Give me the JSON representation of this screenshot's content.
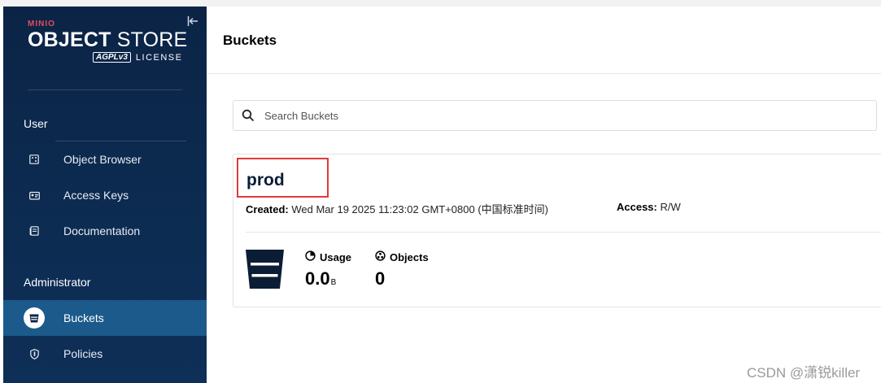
{
  "brand": {
    "minio": "MINIO",
    "object": "OBJECT",
    "store": " STORE",
    "agpl": "AGPLv3",
    "license": "LICENSE",
    "collapse_icon": "collapse-left-icon"
  },
  "sidebar": {
    "user_section": "User",
    "user_items": [
      {
        "label": "Object Browser",
        "icon": "object-browser-icon"
      },
      {
        "label": "Access Keys",
        "icon": "access-keys-icon"
      },
      {
        "label": "Documentation",
        "icon": "documentation-icon"
      }
    ],
    "admin_section": "Administrator",
    "admin_items": [
      {
        "label": "Buckets",
        "icon": "bucket-icon",
        "active": true
      },
      {
        "label": "Policies",
        "icon": "policies-icon"
      }
    ]
  },
  "page": {
    "title": "Buckets"
  },
  "search": {
    "placeholder": "Search Buckets",
    "value": ""
  },
  "bucket": {
    "name": "prod",
    "created_label": "Created:",
    "created_value": "Wed Mar 19 2025 11:23:02 GMT+0800 (中国标准时间)",
    "access_label": "Access:",
    "access_value": "R/W",
    "usage_label": "Usage",
    "usage_value": "0.0",
    "usage_unit": "B",
    "objects_label": "Objects",
    "objects_value": "0"
  },
  "watermark": "CSDN @潇锐killer",
  "colors": {
    "sidebar": "#0b2446",
    "active_item": "#1b5a8a",
    "highlight_box": "#e03a3a",
    "brand_red": "#e64c5b"
  }
}
